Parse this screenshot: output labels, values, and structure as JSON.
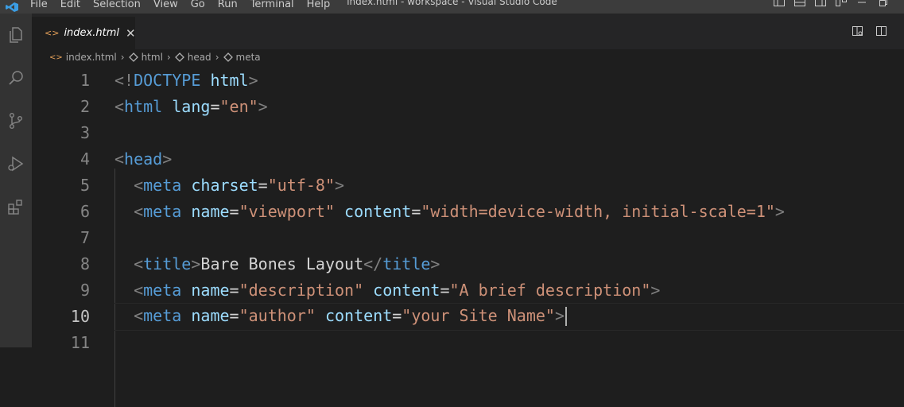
{
  "window": {
    "title": "index.html - workspace - Visual Studio Code",
    "menu": [
      "File",
      "Edit",
      "Selection",
      "View",
      "Go",
      "Run",
      "Terminal",
      "Help"
    ]
  },
  "activity_bar": [
    "explorer-icon",
    "search-icon",
    "source-control-icon",
    "run-debug-icon",
    "extensions-icon"
  ],
  "tab": {
    "icon": "html-file-icon",
    "label": "index.html",
    "close": "✕"
  },
  "breadcrumb": [
    "index.html",
    "html",
    "head",
    "meta"
  ],
  "editor": {
    "current_line": 10,
    "lines": [
      {
        "n": "1",
        "tokens": [
          [
            "p",
            "<!"
          ],
          [
            "tag",
            "DOCTYPE"
          ],
          [
            "txt",
            " "
          ],
          [
            "attr",
            "html"
          ],
          [
            "p",
            ">"
          ]
        ]
      },
      {
        "n": "2",
        "tokens": [
          [
            "p",
            "<"
          ],
          [
            "tag",
            "html"
          ],
          [
            "txt",
            " "
          ],
          [
            "attr",
            "lang"
          ],
          [
            "txt",
            "="
          ],
          [
            "str",
            "\"en\""
          ],
          [
            "p",
            ">"
          ]
        ]
      },
      {
        "n": "3",
        "tokens": []
      },
      {
        "n": "4",
        "tokens": [
          [
            "p",
            "<"
          ],
          [
            "tag",
            "head"
          ],
          [
            "p",
            ">"
          ]
        ]
      },
      {
        "n": "5",
        "tokens": [
          [
            "txt",
            "  "
          ],
          [
            "p",
            "<"
          ],
          [
            "tag",
            "meta"
          ],
          [
            "txt",
            " "
          ],
          [
            "attr",
            "charset"
          ],
          [
            "txt",
            "="
          ],
          [
            "str",
            "\"utf-8\""
          ],
          [
            "p",
            ">"
          ]
        ]
      },
      {
        "n": "6",
        "tokens": [
          [
            "txt",
            "  "
          ],
          [
            "p",
            "<"
          ],
          [
            "tag",
            "meta"
          ],
          [
            "txt",
            " "
          ],
          [
            "attr",
            "name"
          ],
          [
            "txt",
            "="
          ],
          [
            "str",
            "\"viewport\""
          ],
          [
            "txt",
            " "
          ],
          [
            "attr",
            "content"
          ],
          [
            "txt",
            "="
          ],
          [
            "str",
            "\"width=device-width, initial-scale=1\""
          ],
          [
            "p",
            ">"
          ]
        ]
      },
      {
        "n": "7",
        "tokens": []
      },
      {
        "n": "8",
        "tokens": [
          [
            "txt",
            "  "
          ],
          [
            "p",
            "<"
          ],
          [
            "tag",
            "title"
          ],
          [
            "p",
            ">"
          ],
          [
            "txt",
            "Bare Bones Layout"
          ],
          [
            "p",
            "</"
          ],
          [
            "tag",
            "title"
          ],
          [
            "p",
            ">"
          ]
        ]
      },
      {
        "n": "9",
        "tokens": [
          [
            "txt",
            "  "
          ],
          [
            "p",
            "<"
          ],
          [
            "tag",
            "meta"
          ],
          [
            "txt",
            " "
          ],
          [
            "attr",
            "name"
          ],
          [
            "txt",
            "="
          ],
          [
            "str",
            "\"description\""
          ],
          [
            "txt",
            " "
          ],
          [
            "attr",
            "content"
          ],
          [
            "txt",
            "="
          ],
          [
            "str",
            "\"A brief description\""
          ],
          [
            "p",
            ">"
          ]
        ]
      },
      {
        "n": "10",
        "tokens": [
          [
            "txt",
            "  "
          ],
          [
            "p",
            "<"
          ],
          [
            "tag",
            "meta"
          ],
          [
            "txt",
            " "
          ],
          [
            "attr",
            "name"
          ],
          [
            "txt",
            "="
          ],
          [
            "str",
            "\"author\""
          ],
          [
            "txt",
            " "
          ],
          [
            "attr",
            "content"
          ],
          [
            "txt",
            "="
          ],
          [
            "str",
            "\"your Site Name\""
          ],
          [
            "p",
            ">"
          ]
        ]
      },
      {
        "n": "11",
        "tokens": []
      }
    ]
  },
  "colors": {
    "tag": "#569cd6",
    "attr": "#9cdcfe",
    "string": "#ce9178",
    "punct": "#808080",
    "text": "#d4d4d4",
    "accent_icon": "#e8a25a"
  }
}
